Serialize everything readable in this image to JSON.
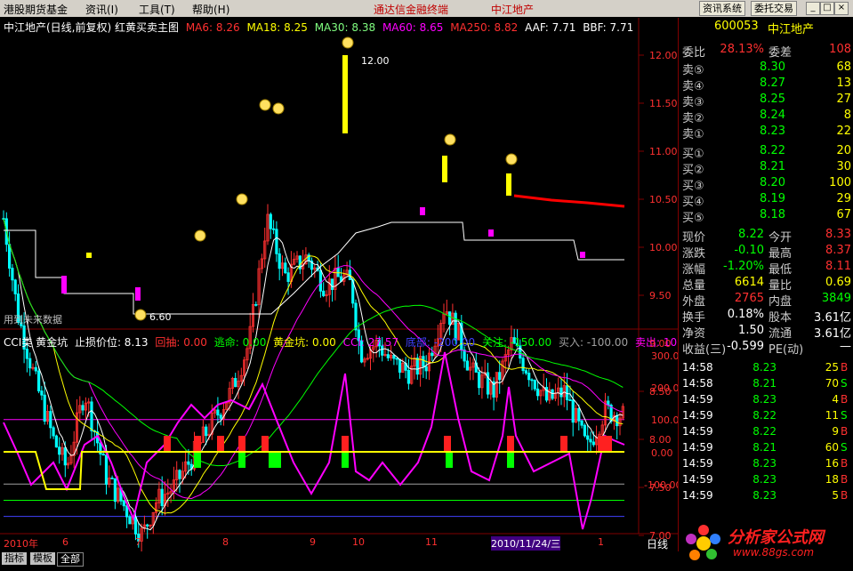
{
  "menu": {
    "items": [
      "港股期货基金",
      "资讯(I)",
      "工具(T)",
      "帮助(H)"
    ],
    "app_title": "通达信金融终端",
    "stock_title": "中江地产",
    "btn_news": "资讯系统",
    "btn_trade": "委托交易"
  },
  "main_header": {
    "title": "中江地产(日线,前复权) 红黄买卖主图",
    "ma6": "MA6: 8.26",
    "ma18": "MA18: 8.25",
    "ma30": "MA30: 8.38",
    "ma60": "MA60: 8.65",
    "ma250": "MA250: 8.82",
    "aaf": "AAF: 7.71",
    "bbf": "BBF: 7.71"
  },
  "sub_header": {
    "title": "CCI类 黄金坑",
    "stop": "止损价位: 8.13",
    "pullback": "回抽: 0.00",
    "escape": "逃命: 0.00",
    "goldpit": "黄金坑: 0.00",
    "cci": "CCI: 27.57",
    "bottom": "底部: -200.00",
    "watch": "关注: -150.00",
    "buy": "买入: -100.00",
    "sell": "卖出: 10"
  },
  "annotations": {
    "high_label": "12.00",
    "low_label": "6.60",
    "watermark": "用到未来数据"
  },
  "price_axis": [
    "12.00",
    "11.50",
    "11.00",
    "10.50",
    "10.00",
    "9.50",
    "9.00",
    "8.50",
    "8.00",
    "7.50",
    "7.00"
  ],
  "cci_axis": [
    "300.00",
    "200.00",
    "100.00",
    "0.00",
    "-100.00"
  ],
  "date_axis": [
    "2010年",
    "6",
    "7",
    "8",
    "9",
    "10",
    "11",
    "2010/11/24/三",
    "1"
  ],
  "period": "日线",
  "tabs": [
    "指标",
    "模板",
    "全部"
  ],
  "quote": {
    "code": "600053",
    "name": "中江地产",
    "weibi_label": "委比",
    "weibi": "28.13%",
    "weicha_label": "委差",
    "weicha": "108",
    "asks": [
      {
        "label": "卖⑤",
        "price": "8.30",
        "vol": "68"
      },
      {
        "label": "卖④",
        "price": "8.27",
        "vol": "13"
      },
      {
        "label": "卖③",
        "price": "8.25",
        "vol": "27"
      },
      {
        "label": "卖②",
        "price": "8.24",
        "vol": "8"
      },
      {
        "label": "卖①",
        "price": "8.23",
        "vol": "22"
      }
    ],
    "bids": [
      {
        "label": "买①",
        "price": "8.22",
        "vol": "20"
      },
      {
        "label": "买②",
        "price": "8.21",
        "vol": "30"
      },
      {
        "label": "买③",
        "price": "8.20",
        "vol": "100"
      },
      {
        "label": "买④",
        "price": "8.19",
        "vol": "29"
      },
      {
        "label": "买⑤",
        "price": "8.18",
        "vol": "67"
      }
    ],
    "stats": [
      {
        "l": "现价",
        "v": "8.22",
        "l2": "今开",
        "v2": "8.33"
      },
      {
        "l": "涨跌",
        "v": "-0.10",
        "l2": "最高",
        "v2": "8.37"
      },
      {
        "l": "涨幅",
        "v": "-1.20%",
        "l2": "最低",
        "v2": "8.11"
      },
      {
        "l": "总量",
        "v": "6614",
        "l2": "量比",
        "v2": "0.69"
      },
      {
        "l": "外盘",
        "v": "2765",
        "l2": "内盘",
        "v2": "3849"
      },
      {
        "l": "换手",
        "v": "0.18%",
        "l2": "股本",
        "v2": "3.61亿"
      },
      {
        "l": "净资",
        "v": "1.50",
        "l2": "流通",
        "v2": "3.61亿"
      },
      {
        "l": "收益(三)",
        "v": "-0.599",
        "l2": "PE(动)",
        "v2": "—"
      }
    ],
    "ticks": [
      {
        "t": "14:58",
        "p": "8.23",
        "q": "25",
        "s": "B"
      },
      {
        "t": "14:58",
        "p": "8.21",
        "q": "70",
        "s": "S"
      },
      {
        "t": "14:59",
        "p": "8.23",
        "q": "4",
        "s": "B"
      },
      {
        "t": "14:59",
        "p": "8.22",
        "q": "11",
        "s": "S"
      },
      {
        "t": "14:59",
        "p": "8.22",
        "q": "9",
        "s": "B"
      },
      {
        "t": "14:59",
        "p": "8.21",
        "q": "60",
        "s": "S"
      },
      {
        "t": "14:59",
        "p": "8.23",
        "q": "16",
        "s": "B"
      },
      {
        "t": "14:59",
        "p": "8.23",
        "q": "18",
        "s": "B"
      },
      {
        "t": "14:59",
        "p": "8.23",
        "q": "5",
        "s": "B"
      }
    ]
  },
  "logo": {
    "text1": "分析家公式网",
    "text2": "www.88gs.com"
  },
  "colors": {
    "up": "#ff3030",
    "down": "#00ffff",
    "ma6": "#ffffff",
    "ma18": "#ffff00",
    "ma30": "#ff00ff",
    "ma60": "#00ff00",
    "cci": "#ff00ff"
  }
}
